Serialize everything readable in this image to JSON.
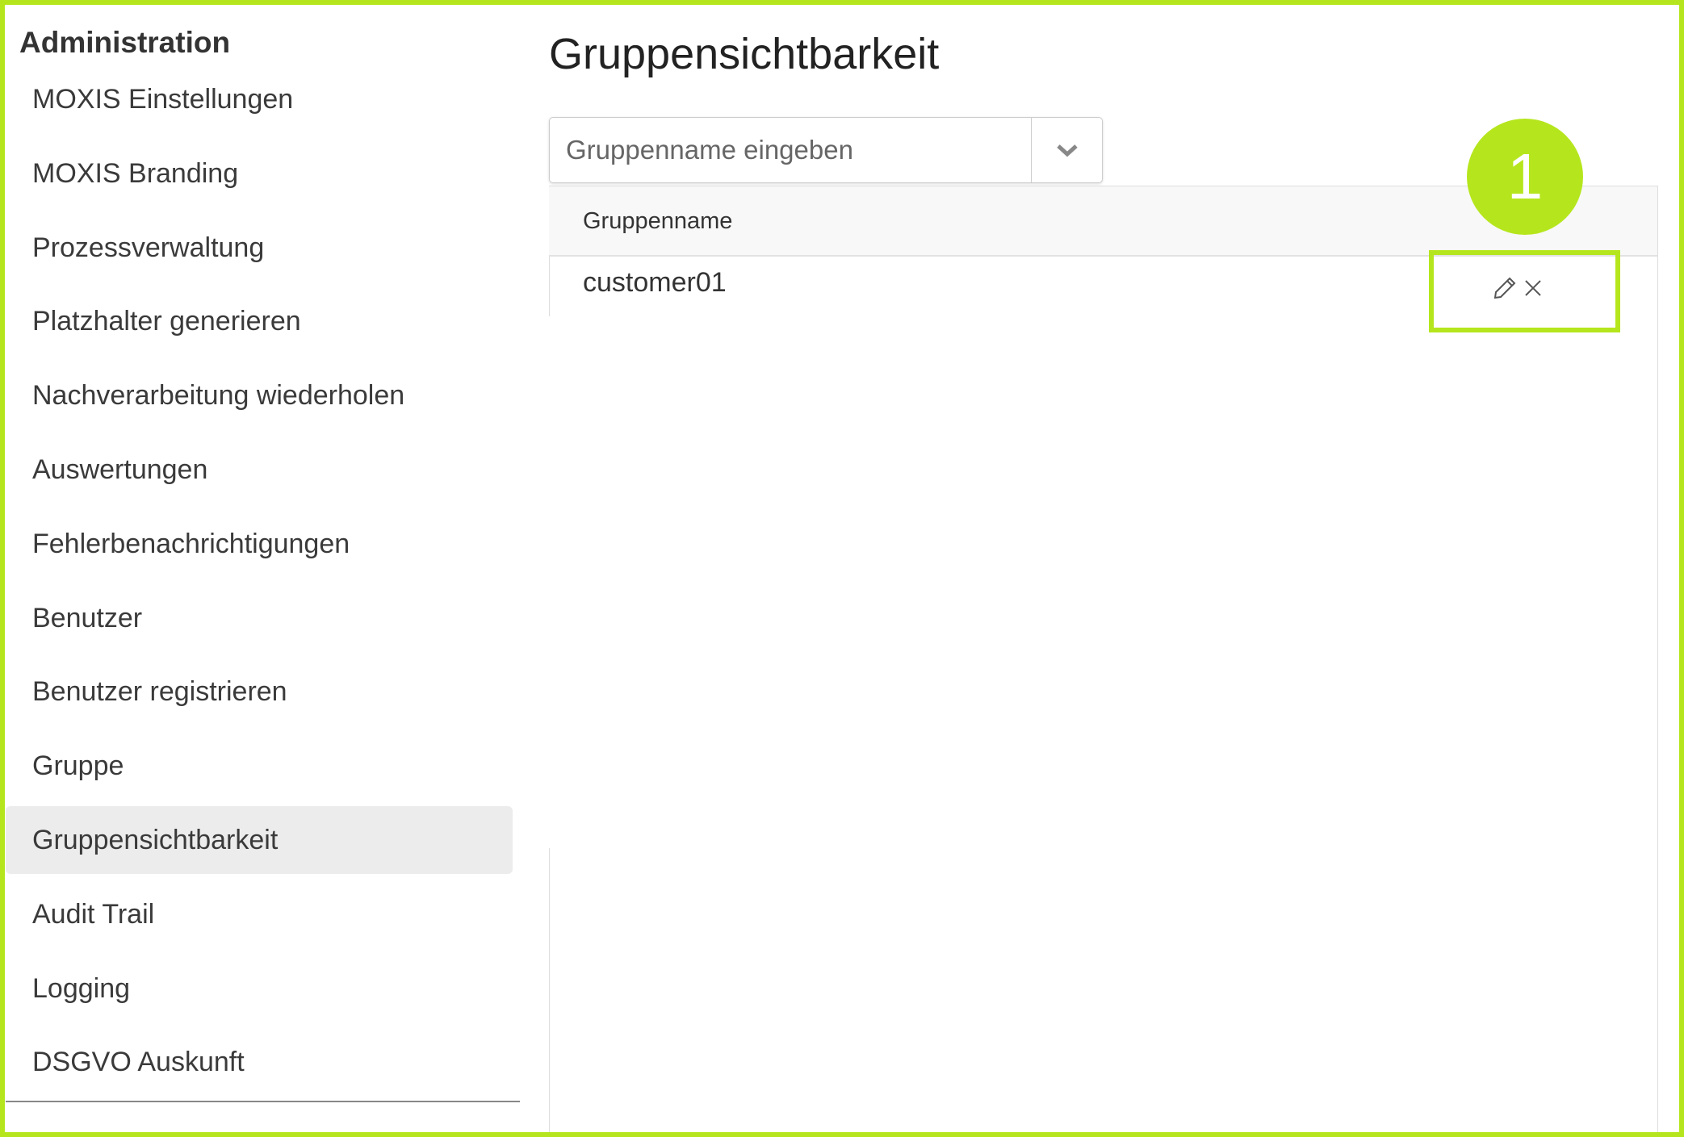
{
  "sidebar": {
    "title": "Administration",
    "items": [
      {
        "label": "MOXIS Einstellungen"
      },
      {
        "label": "MOXIS Branding"
      },
      {
        "label": "Prozessverwaltung"
      },
      {
        "label": "Platzhalter generieren"
      },
      {
        "label": "Nachverarbeitung wiederholen"
      },
      {
        "label": "Auswertungen"
      },
      {
        "label": "Fehlerbenachrichtigungen"
      },
      {
        "label": "Benutzer"
      },
      {
        "label": "Benutzer registrieren"
      },
      {
        "label": "Gruppe"
      },
      {
        "label": "Gruppensichtbarkeit",
        "active": true
      },
      {
        "label": "Audit Trail"
      },
      {
        "label": "Logging"
      },
      {
        "label": "DSGVO Auskunft"
      }
    ]
  },
  "main": {
    "title": "Gruppensichtbarkeit",
    "group_input": {
      "placeholder": "Gruppenname eingeben",
      "icon": "chevron-down-icon"
    },
    "table": {
      "columns": [
        "Gruppenname"
      ],
      "rows": [
        {
          "name": "customer01",
          "actions": [
            "pencil-icon",
            "close-icon"
          ]
        }
      ]
    }
  },
  "annotation": {
    "badge": "1",
    "color": "#b5e61d"
  }
}
